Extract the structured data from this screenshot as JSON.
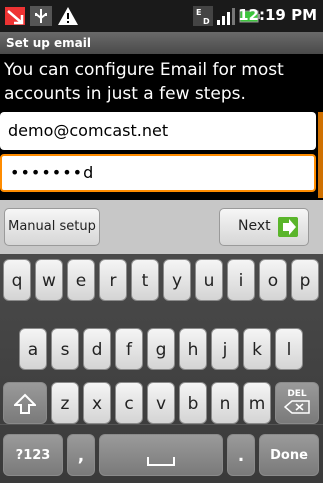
{
  "status_bar": {
    "time": "12:19 PM",
    "icons": [
      "missed-call-icon",
      "usb-debug-icon",
      "warning-icon",
      "eu-network-icon",
      "signal-icon",
      "battery-icon"
    ]
  },
  "header": {
    "title": "Set up email"
  },
  "main": {
    "intro": "You can configure Email for most accounts in just a few steps.",
    "email_value": "demo@comcast.net",
    "password_value": "•••••••d"
  },
  "buttons": {
    "manual_setup": "Manual setup",
    "next": "Next"
  },
  "keyboard": {
    "row1": [
      "q",
      "w",
      "e",
      "r",
      "t",
      "y",
      "u",
      "i",
      "o",
      "p"
    ],
    "row2": [
      "a",
      "s",
      "d",
      "f",
      "g",
      "h",
      "j",
      "k",
      "l"
    ],
    "row3": [
      "z",
      "x",
      "c",
      "v",
      "b",
      "n",
      "m"
    ],
    "shift_icon": "shift-icon",
    "del_label": "DEL",
    "sym_label": "?123",
    "comma_label": ",",
    "space_icon": "space-bar-icon",
    "period_label": ".",
    "done_label": "Done"
  },
  "colors": {
    "focus_border": "#ff8c00",
    "next_arrow": "#5ab52b",
    "title_bar": "#5a5a5a"
  }
}
